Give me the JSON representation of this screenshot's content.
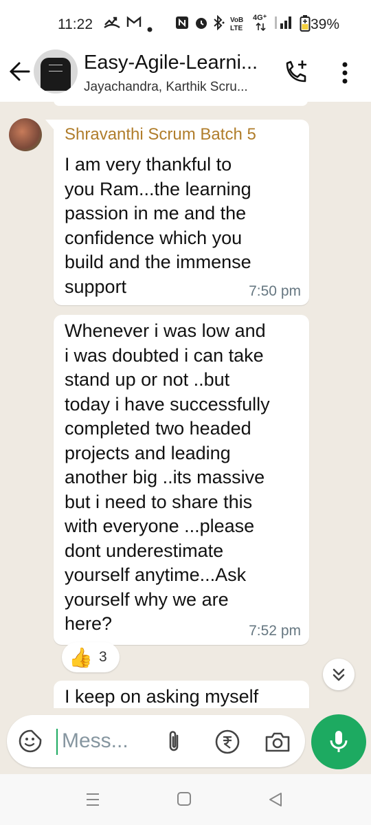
{
  "status_bar": {
    "time": "11:22",
    "battery": "39%",
    "icons": [
      "missed-call-icon",
      "gmail-icon",
      "dot-icon",
      "nfc-icon",
      "alarm-icon",
      "bluetooth-icon",
      "volte-icon",
      "4g-icon",
      "signal-icon",
      "battery-icon"
    ],
    "network_label": "4G⁺"
  },
  "header": {
    "title": "Easy-Agile-Learni...",
    "subtitle": "Jayachandra, Karthik Scru..."
  },
  "messages": [
    {
      "sender": "Shravanthi Scrum Batch 5",
      "text": "I am very thankful to\nyou Ram...the learning\npassion in me and the\nconfidence which you\nbuild and the immense\nsupport",
      "time": "7:50 pm"
    },
    {
      "text": "Whenever i was low and\ni was doubted i can take\nstand up or not ..but\ntoday i have successfully\ncompleted two headed\nprojects and leading\nanother big ..its massive\nbut i need to share this\nwith everyone ...please\ndont underestimate\nyourself anytime...Ask\nyourself why we are\nhere?",
      "time": "7:52 pm",
      "reaction": {
        "emoji": "👍",
        "count": "3"
      }
    },
    {
      "text": "I keep on asking myself"
    }
  ],
  "input": {
    "placeholder": "Mess..."
  },
  "colors": {
    "accent": "#1daa61",
    "sender_name": "#b07d2b",
    "chat_background": "#efeae2",
    "timestamp": "#667781"
  }
}
